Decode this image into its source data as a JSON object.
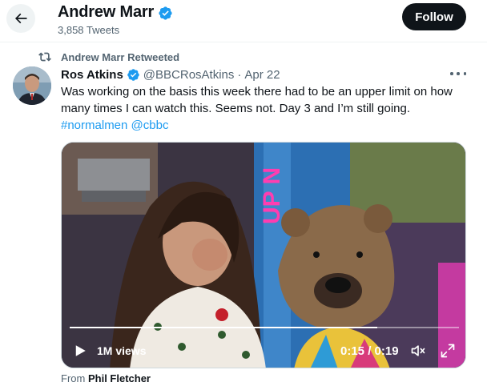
{
  "header": {
    "title": "Andrew Marr",
    "tweet_count": "3,858 Tweets",
    "follow_label": "Follow",
    "back_icon": "arrow-left-icon",
    "verified_icon": "verified-badge-icon"
  },
  "tweet": {
    "retweet_label": "Andrew Marr Retweeted",
    "author_name": "Ros Atkins",
    "handle": "@BBCRosAtkins",
    "separator": "·",
    "date": "Apr 22",
    "text_line1": "Was working on the basis this week  there had to be an upper limit on how",
    "text_line2": "many times I can watch this. Seems not. Day 3 and I’m still going.",
    "hashtag": "#normalmen",
    "mention": "@cbbc",
    "more_icon": "more-horizontal-icon"
  },
  "media": {
    "views": "1M views",
    "time": "0:15 / 0:19",
    "progress": 0.79,
    "sign_text": "UP N",
    "play_icon": "play-icon",
    "volume_icon": "volume-icon",
    "fullscreen_icon": "fullscreen-icon"
  },
  "from": {
    "prefix": "From",
    "author": "Phil Fletcher"
  },
  "colors": {
    "accent": "#1d9bf0",
    "text": "#0f1419",
    "muted": "#536471",
    "follow_bg": "#0f1419"
  }
}
